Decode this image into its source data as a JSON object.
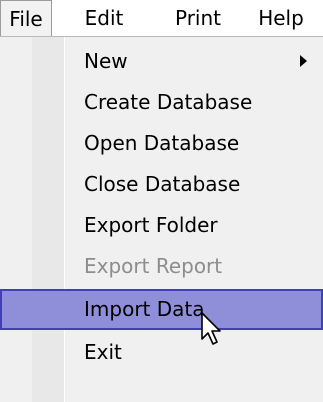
{
  "menubar": {
    "items": [
      {
        "label": "File",
        "active": true
      },
      {
        "label": "Edit",
        "active": false
      },
      {
        "label": "Print",
        "active": false
      },
      {
        "label": "Help",
        "active": false
      }
    ]
  },
  "file_menu": {
    "items": [
      {
        "label": "New",
        "has_submenu": true,
        "disabled": false,
        "highlighted": false
      },
      {
        "label": "Create Database",
        "has_submenu": false,
        "disabled": false,
        "highlighted": false
      },
      {
        "label": "Open Database",
        "has_submenu": false,
        "disabled": false,
        "highlighted": false
      },
      {
        "label": "Close Database",
        "has_submenu": false,
        "disabled": false,
        "highlighted": false
      },
      {
        "label": "Export Folder",
        "has_submenu": false,
        "disabled": false,
        "highlighted": false
      },
      {
        "label": "Export Report",
        "has_submenu": false,
        "disabled": true,
        "highlighted": false
      },
      {
        "label": "Import Data",
        "has_submenu": false,
        "disabled": false,
        "highlighted": true
      },
      {
        "label": "Exit",
        "has_submenu": false,
        "disabled": false,
        "highlighted": false
      }
    ]
  },
  "colors": {
    "highlight_fill": "#8f8fd9",
    "highlight_border": "#3f3fb8",
    "disabled_text": "#8d8d8d",
    "menu_background": "#f0f0f0"
  },
  "cursor": {
    "icon": "arrow-pointer-icon"
  }
}
